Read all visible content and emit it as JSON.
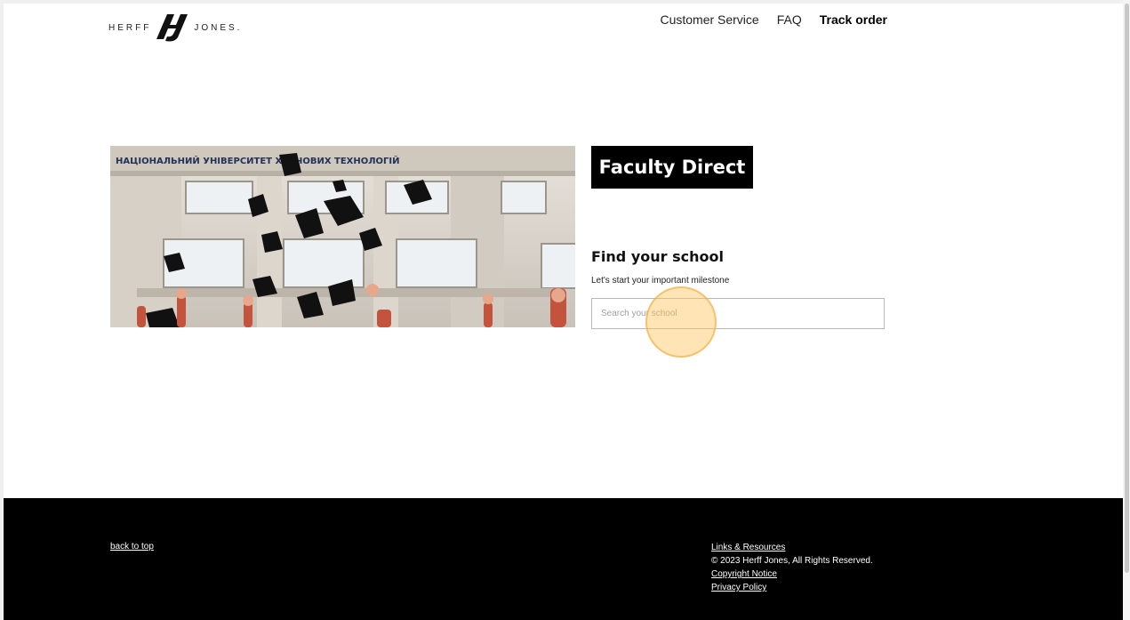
{
  "header": {
    "logo_left": "HERFF",
    "logo_right": "JONES.",
    "nav": [
      {
        "label": "Customer Service",
        "bold": false
      },
      {
        "label": "FAQ",
        "bold": false
      },
      {
        "label": "Track order",
        "bold": true
      }
    ]
  },
  "hero": {
    "image_icon": "graduation-photo",
    "banner_text": "НАЦІОНАЛЬНИЙ УНІВЕРСИТЕТ ХАРЧОВИХ ТЕХНОЛОГІЙ"
  },
  "main": {
    "badge": "Faculty Direct",
    "find_title": "Find your school",
    "find_subtitle": "Let's start your important milestone",
    "search_placeholder": "Search your school",
    "search_value": ""
  },
  "footer": {
    "back_to_top": "back to top",
    "links_resources": "Links & Resources",
    "copyright": "© 2023 Herff Jones, All Rights Reserved.",
    "copyright_notice": "Copyright Notice",
    "privacy_policy": "Privacy Policy"
  },
  "colors": {
    "badge_bg": "#000000",
    "footer_bg": "#000000",
    "cursor_highlight": "#ffc45a"
  }
}
